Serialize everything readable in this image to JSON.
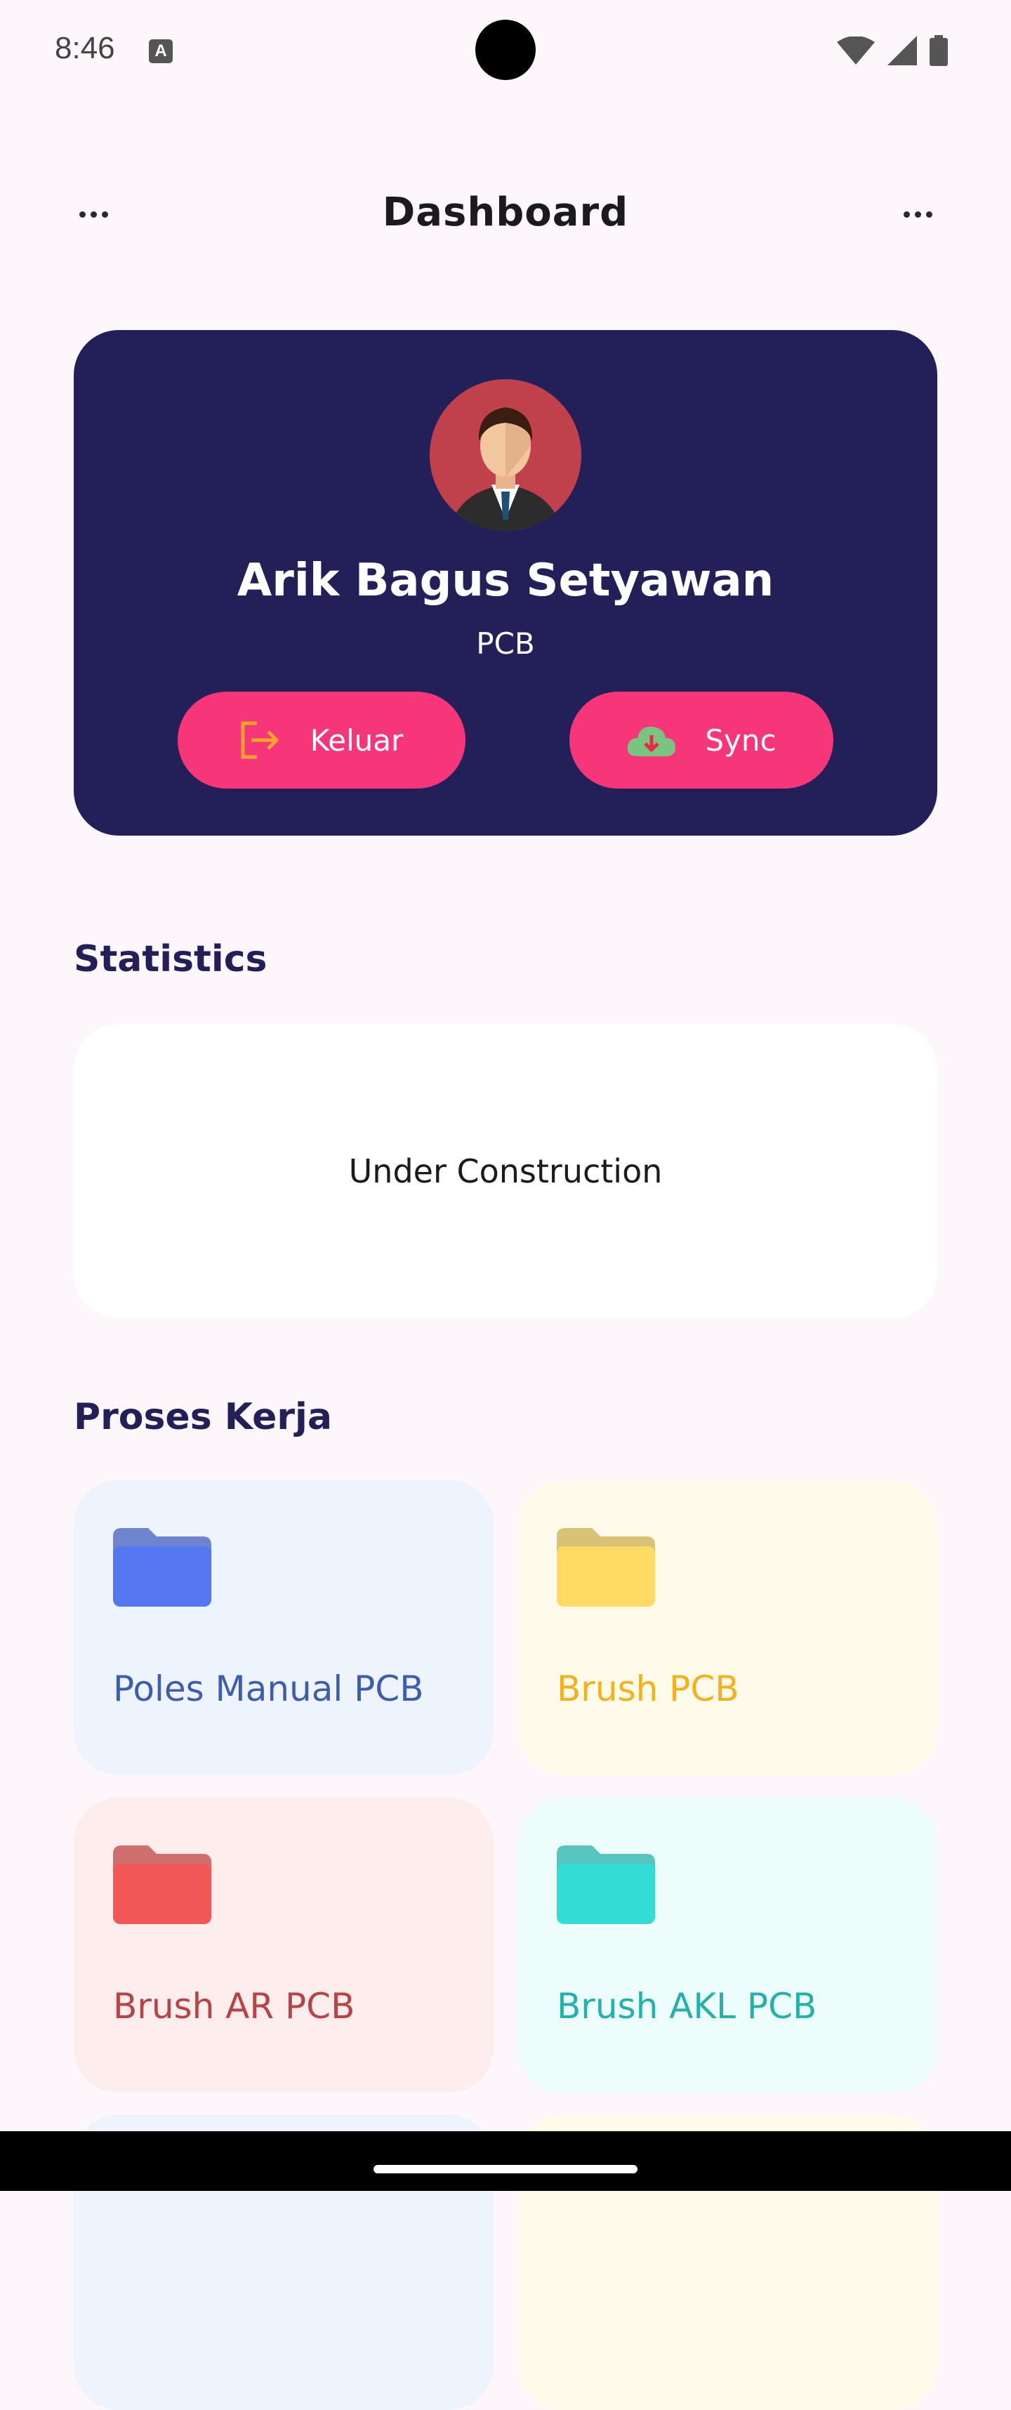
{
  "status_bar": {
    "time": "8:46",
    "notification_letter": "A"
  },
  "app_bar": {
    "title": "Dashboard"
  },
  "profile": {
    "name": "Arik Bagus Setyawan",
    "department": "PCB",
    "logout_label": "Keluar",
    "sync_label": "Sync"
  },
  "statistics": {
    "title": "Statistics",
    "placeholder": "Under Construction"
  },
  "proses": {
    "title": "Proses Kerja",
    "items": [
      {
        "label": "Poles Manual PCB",
        "bg": "#EDF4FD",
        "text_color": "#3E5CB0",
        "folder_color": "#5577F0"
      },
      {
        "label": "Brush PCB",
        "bg": "#FEFBEA",
        "text_color": "#F6B01E",
        "folder_color": "#FFDB63"
      },
      {
        "label": "Brush AR PCB",
        "bg": "#FDEDEC",
        "text_color": "#B64447",
        "folder_color": "#F25757"
      },
      {
        "label": "Brush AKL PCB",
        "bg": "#ECFDFB",
        "text_color": "#26B0AB",
        "folder_color": "#33DDD5"
      }
    ]
  }
}
